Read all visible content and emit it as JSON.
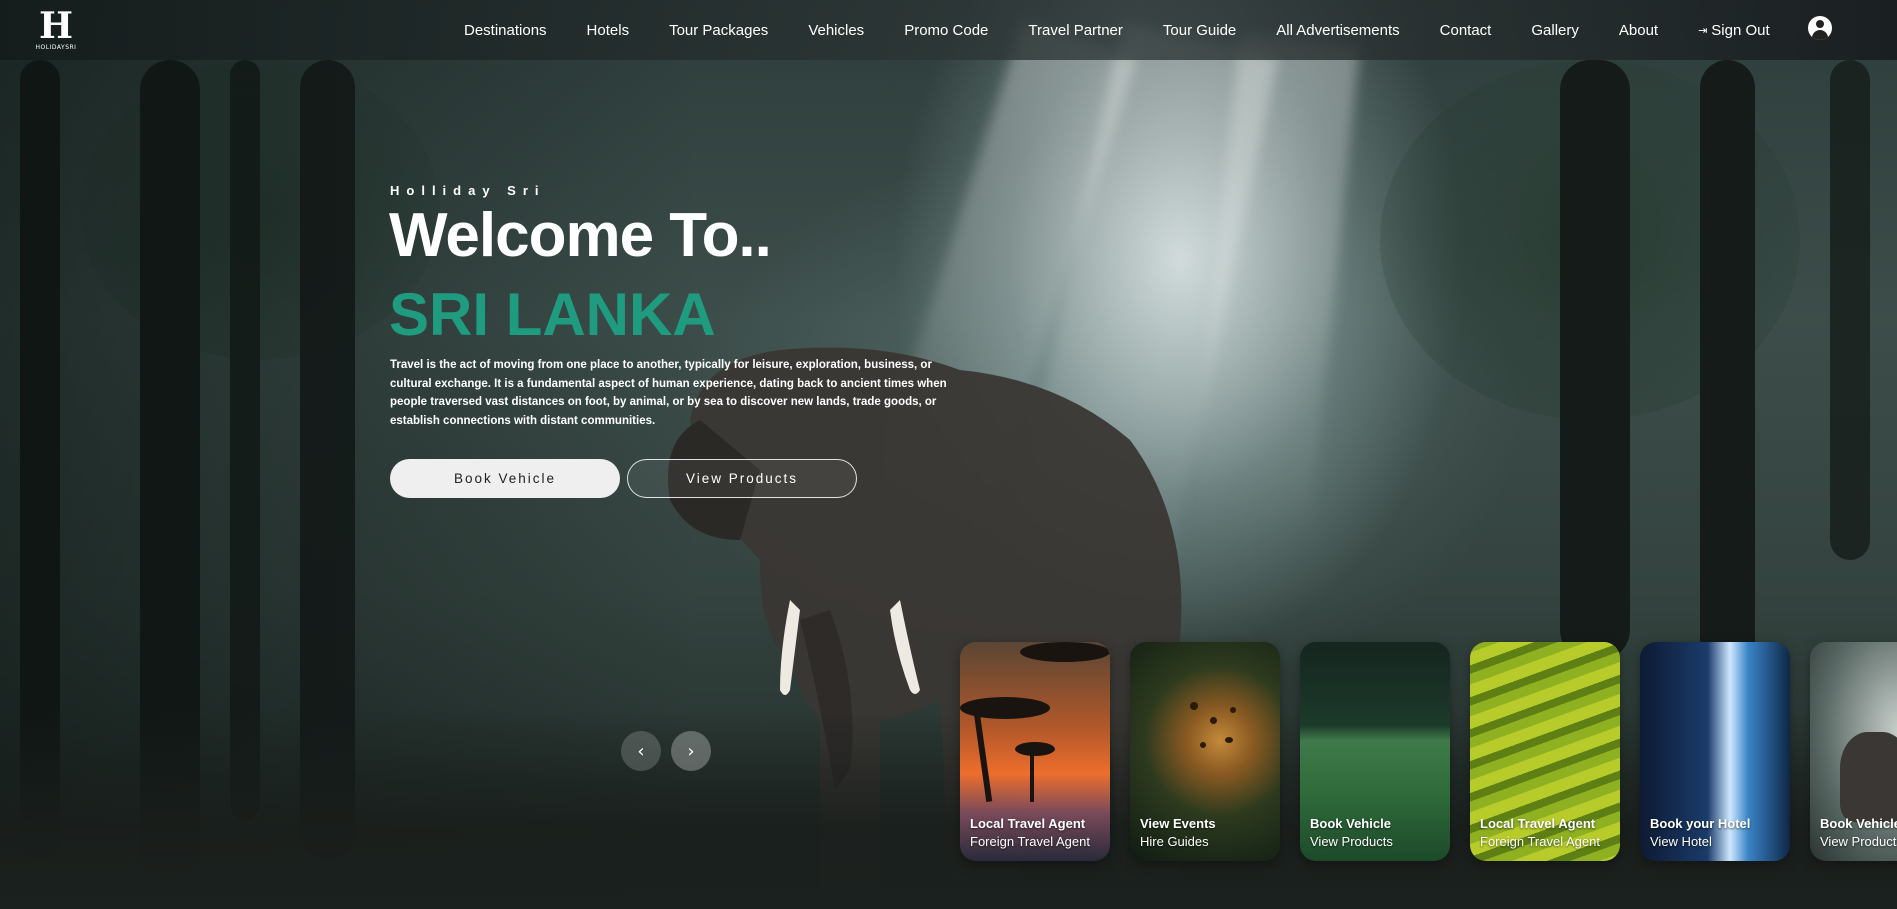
{
  "brand": {
    "logo_mark": "H",
    "logo_text": "HOLIDAYSRI"
  },
  "nav": {
    "items": [
      "Destinations",
      "Hotels",
      "Tour Packages",
      "Vehicles",
      "Promo Code",
      "Travel Partner",
      "Tour Guide",
      "All Advertisements",
      "Contact",
      "Gallery",
      "About"
    ],
    "sign_out": "Sign Out"
  },
  "hero": {
    "eyebrow": "Holliday Sri",
    "heading": "Welcome To..",
    "highlight": "SRI LANKA",
    "highlight_color": "#1f9c80",
    "description": "Travel is the act of moving from one place to another, typically for leisure, exploration, business, or cultural exchange. It is a fundamental aspect of human experience, dating back to ancient times when people traversed vast distances on foot, by animal, or by sea to discover new lands, trade goods, or establish connections with distant communities.",
    "primary_button": "Book Vehicle",
    "secondary_button": "View Products"
  },
  "slider": {
    "prev_icon": "‹",
    "next_icon": "›"
  },
  "cards": [
    {
      "title": "Local Travel Agent",
      "subtitle": "Foreign Travel Agent",
      "image": "sunset-acacia-tree"
    },
    {
      "title": "View Events",
      "subtitle": "Hire Guides",
      "image": "leopard"
    },
    {
      "title": "Book Vehicle",
      "subtitle": "View Products",
      "image": "tea-plantation"
    },
    {
      "title": "Local Travel Agent",
      "subtitle": "Foreign Travel Agent",
      "image": "rice-terraces"
    },
    {
      "title": "Book your Hotel",
      "subtitle": "View Hotel",
      "image": "coastline-aerial"
    },
    {
      "title": "Book Vehicle",
      "subtitle": "View Products",
      "image": "elephant-forest"
    }
  ]
}
